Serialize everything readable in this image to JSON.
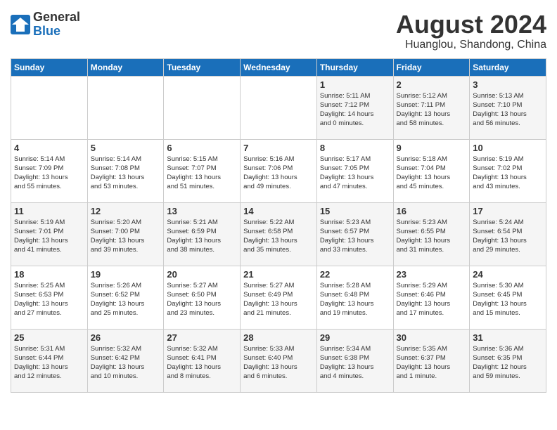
{
  "header": {
    "logo_general": "General",
    "logo_blue": "Blue",
    "month_year": "August 2024",
    "location": "Huanglou, Shandong, China"
  },
  "days_of_week": [
    "Sunday",
    "Monday",
    "Tuesday",
    "Wednesday",
    "Thursday",
    "Friday",
    "Saturday"
  ],
  "weeks": [
    [
      {
        "day": "",
        "info": ""
      },
      {
        "day": "",
        "info": ""
      },
      {
        "day": "",
        "info": ""
      },
      {
        "day": "",
        "info": ""
      },
      {
        "day": "1",
        "info": "Sunrise: 5:11 AM\nSunset: 7:12 PM\nDaylight: 14 hours\nand 0 minutes."
      },
      {
        "day": "2",
        "info": "Sunrise: 5:12 AM\nSunset: 7:11 PM\nDaylight: 13 hours\nand 58 minutes."
      },
      {
        "day": "3",
        "info": "Sunrise: 5:13 AM\nSunset: 7:10 PM\nDaylight: 13 hours\nand 56 minutes."
      }
    ],
    [
      {
        "day": "4",
        "info": "Sunrise: 5:14 AM\nSunset: 7:09 PM\nDaylight: 13 hours\nand 55 minutes."
      },
      {
        "day": "5",
        "info": "Sunrise: 5:14 AM\nSunset: 7:08 PM\nDaylight: 13 hours\nand 53 minutes."
      },
      {
        "day": "6",
        "info": "Sunrise: 5:15 AM\nSunset: 7:07 PM\nDaylight: 13 hours\nand 51 minutes."
      },
      {
        "day": "7",
        "info": "Sunrise: 5:16 AM\nSunset: 7:06 PM\nDaylight: 13 hours\nand 49 minutes."
      },
      {
        "day": "8",
        "info": "Sunrise: 5:17 AM\nSunset: 7:05 PM\nDaylight: 13 hours\nand 47 minutes."
      },
      {
        "day": "9",
        "info": "Sunrise: 5:18 AM\nSunset: 7:04 PM\nDaylight: 13 hours\nand 45 minutes."
      },
      {
        "day": "10",
        "info": "Sunrise: 5:19 AM\nSunset: 7:02 PM\nDaylight: 13 hours\nand 43 minutes."
      }
    ],
    [
      {
        "day": "11",
        "info": "Sunrise: 5:19 AM\nSunset: 7:01 PM\nDaylight: 13 hours\nand 41 minutes."
      },
      {
        "day": "12",
        "info": "Sunrise: 5:20 AM\nSunset: 7:00 PM\nDaylight: 13 hours\nand 39 minutes."
      },
      {
        "day": "13",
        "info": "Sunrise: 5:21 AM\nSunset: 6:59 PM\nDaylight: 13 hours\nand 38 minutes."
      },
      {
        "day": "14",
        "info": "Sunrise: 5:22 AM\nSunset: 6:58 PM\nDaylight: 13 hours\nand 35 minutes."
      },
      {
        "day": "15",
        "info": "Sunrise: 5:23 AM\nSunset: 6:57 PM\nDaylight: 13 hours\nand 33 minutes."
      },
      {
        "day": "16",
        "info": "Sunrise: 5:23 AM\nSunset: 6:55 PM\nDaylight: 13 hours\nand 31 minutes."
      },
      {
        "day": "17",
        "info": "Sunrise: 5:24 AM\nSunset: 6:54 PM\nDaylight: 13 hours\nand 29 minutes."
      }
    ],
    [
      {
        "day": "18",
        "info": "Sunrise: 5:25 AM\nSunset: 6:53 PM\nDaylight: 13 hours\nand 27 minutes."
      },
      {
        "day": "19",
        "info": "Sunrise: 5:26 AM\nSunset: 6:52 PM\nDaylight: 13 hours\nand 25 minutes."
      },
      {
        "day": "20",
        "info": "Sunrise: 5:27 AM\nSunset: 6:50 PM\nDaylight: 13 hours\nand 23 minutes."
      },
      {
        "day": "21",
        "info": "Sunrise: 5:27 AM\nSunset: 6:49 PM\nDaylight: 13 hours\nand 21 minutes."
      },
      {
        "day": "22",
        "info": "Sunrise: 5:28 AM\nSunset: 6:48 PM\nDaylight: 13 hours\nand 19 minutes."
      },
      {
        "day": "23",
        "info": "Sunrise: 5:29 AM\nSunset: 6:46 PM\nDaylight: 13 hours\nand 17 minutes."
      },
      {
        "day": "24",
        "info": "Sunrise: 5:30 AM\nSunset: 6:45 PM\nDaylight: 13 hours\nand 15 minutes."
      }
    ],
    [
      {
        "day": "25",
        "info": "Sunrise: 5:31 AM\nSunset: 6:44 PM\nDaylight: 13 hours\nand 12 minutes."
      },
      {
        "day": "26",
        "info": "Sunrise: 5:32 AM\nSunset: 6:42 PM\nDaylight: 13 hours\nand 10 minutes."
      },
      {
        "day": "27",
        "info": "Sunrise: 5:32 AM\nSunset: 6:41 PM\nDaylight: 13 hours\nand 8 minutes."
      },
      {
        "day": "28",
        "info": "Sunrise: 5:33 AM\nSunset: 6:40 PM\nDaylight: 13 hours\nand 6 minutes."
      },
      {
        "day": "29",
        "info": "Sunrise: 5:34 AM\nSunset: 6:38 PM\nDaylight: 13 hours\nand 4 minutes."
      },
      {
        "day": "30",
        "info": "Sunrise: 5:35 AM\nSunset: 6:37 PM\nDaylight: 13 hours\nand 1 minute."
      },
      {
        "day": "31",
        "info": "Sunrise: 5:36 AM\nSunset: 6:35 PM\nDaylight: 12 hours\nand 59 minutes."
      }
    ]
  ]
}
